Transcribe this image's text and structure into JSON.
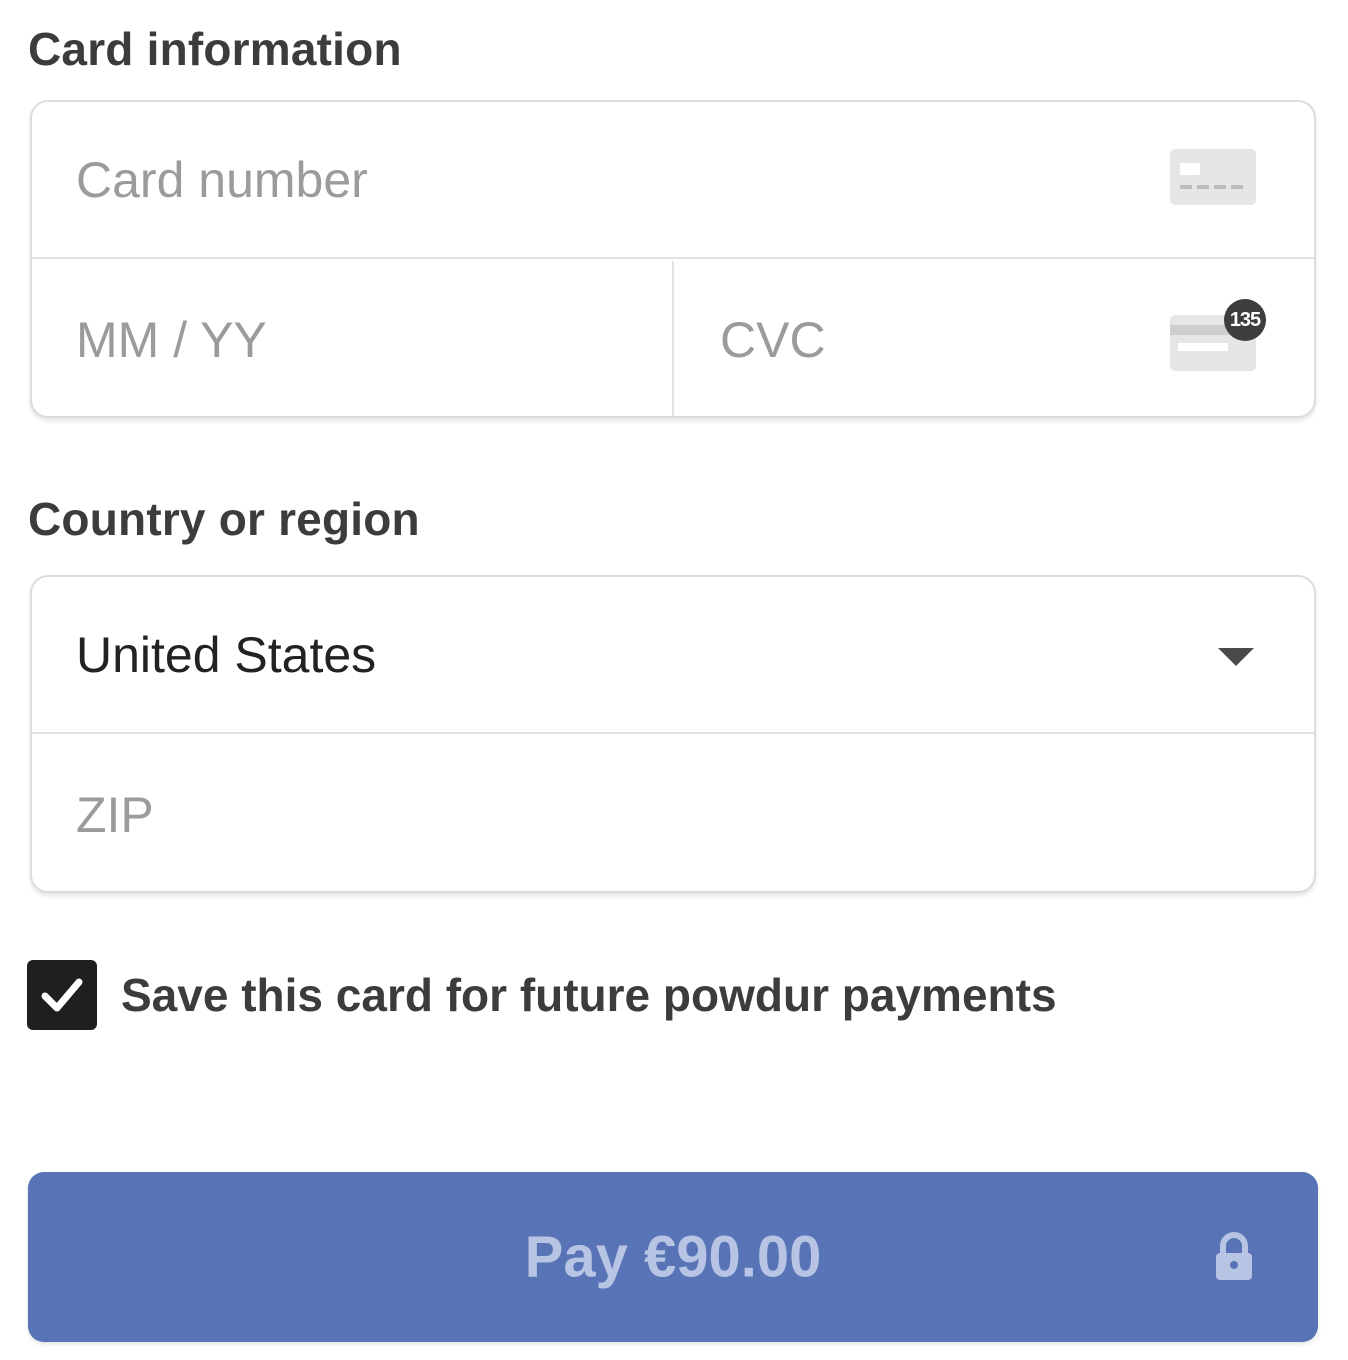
{
  "card_section": {
    "label": "Card information",
    "card_number_placeholder": "Card number",
    "expiry_placeholder": "MM / YY",
    "cvc_placeholder": "CVC",
    "cvc_badge_text": "135"
  },
  "country_section": {
    "label": "Country or region",
    "selected_country": "United States",
    "zip_placeholder": "ZIP"
  },
  "save_card": {
    "checked": true,
    "label": "Save this card for future powdur payments"
  },
  "pay_button": {
    "label": "Pay €90.00",
    "color": "#5874b6"
  },
  "icons": [
    "card-icon",
    "cvc-card-icon",
    "chevron-down-icon",
    "checkmark-icon",
    "lock-icon"
  ]
}
